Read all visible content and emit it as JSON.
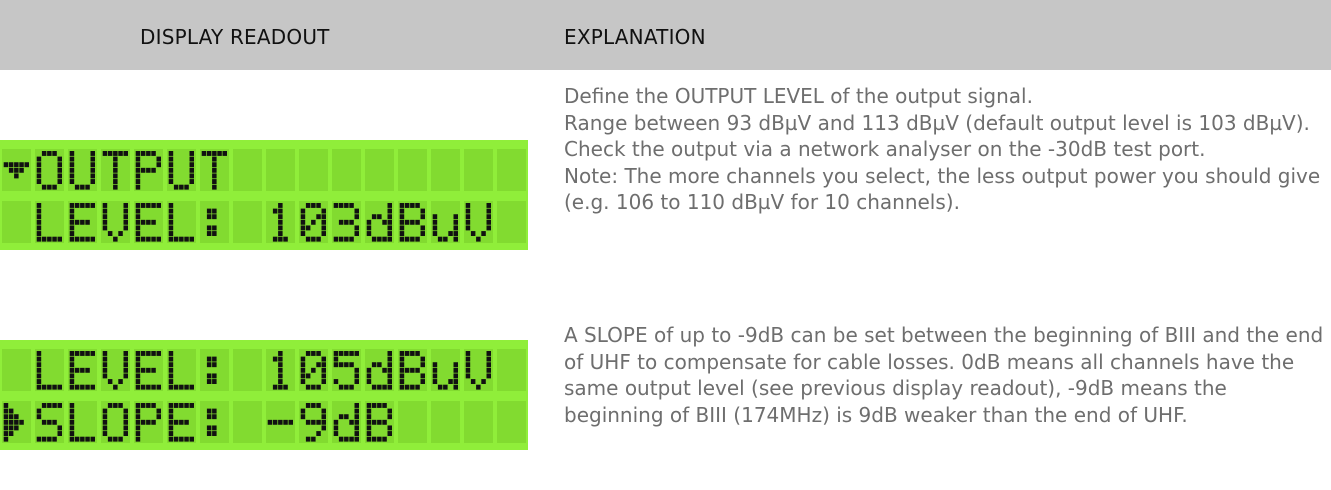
{
  "table": {
    "headers": {
      "display": "DISPLAY READOUT",
      "explanation": "EXPLANATION"
    },
    "rows": [
      {
        "lcd": {
          "line1_cursor": "down-arrow",
          "line1": "OUTPUT",
          "line2": "LEVEL: 103dBuV"
        },
        "explanation": {
          "p1": "Define the OUTPUT LEVEL of the output signal.",
          "p2": "Range between 93 dBµV and 113 dBµV (default output level is 103 dBµV). Check the output via a network analyser on the -30dB test port.",
          "p3": "Note: The more channels you select, the less output power you should give (e.g. 106 to 110 dBµV for 10 channels)."
        }
      },
      {
        "lcd": {
          "line1": "LEVEL: 105dBuV",
          "line2_cursor": "right-triangle",
          "line2": "SLOPE: -9dB"
        },
        "explanation": {
          "p1": "A SLOPE of up to -9dB can be set between the beginning of BIII and the end of UHF to compensate for cable losses. 0dB means all channels have the same output level (see previous display readout), -9dB means the beginning of BIII (174MHz) is 9dB weaker than the end of UHF."
        }
      }
    ]
  },
  "colors": {
    "header_bg": "#c6c6c6",
    "lcd_bg": "#90ee3a",
    "lcd_cell_bg": "#82db30",
    "lcd_pixel_on": "#111111",
    "text_gray": "#6e6e6e"
  }
}
